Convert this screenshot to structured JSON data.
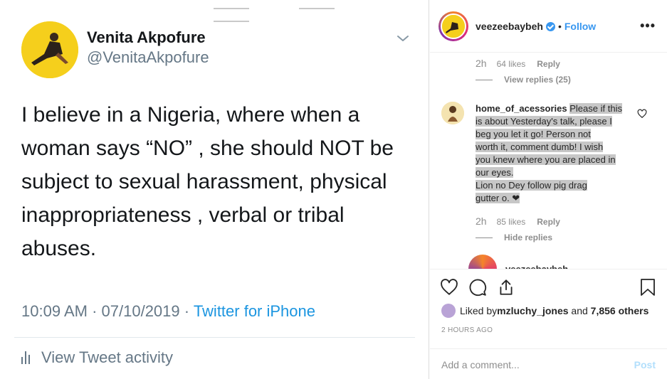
{
  "tweet": {
    "name": "Venita Akpofure",
    "handle": "@VenitaAkpofure",
    "text": "I believe in a Nigeria, where when a woman says “NO” , she should NOT be subject to sexual harassment, physical inappropriateness , verbal or tribal abuses.",
    "time": "10:09 AM",
    "date": "07/10/2019",
    "source": "Twitter for iPhone",
    "activity_label": "View Tweet activity",
    "accent": "#1b95e0",
    "avatar_color": "#f5cf1c"
  },
  "instagram": {
    "header": {
      "username": "veezeebaybeh",
      "follow_label": "Follow",
      "more_icon": "more-horizontal-icon"
    },
    "prev_comment": {
      "time": "2h",
      "likes": "64 likes",
      "reply_label": "Reply",
      "view_replies": "View replies (25)"
    },
    "comment": {
      "username": "home_of_acessories",
      "text_lines": [
        "Please if this",
        "is about Yesterday's talk, please I",
        "beg you let it go! Person not",
        "worth it, comment dumb! I wish",
        "you knew where you are placed in",
        "our eyes.",
        "Lion no Dey follow pig drag",
        "gutter o. ❤"
      ],
      "time": "2h",
      "likes": "85 likes",
      "reply_label": "Reply",
      "hide_replies": "Hide replies"
    },
    "reply_peek": {
      "username": "veezeebaybeh"
    },
    "actions": {
      "liked_prefix": "Liked by ",
      "liked_user": "mzluchy_jones",
      "liked_middle": " and ",
      "liked_count": "7,856 others",
      "post_time": "2 HOURS AGO"
    },
    "add_comment": {
      "placeholder": "Add a comment...",
      "post_label": "Post"
    },
    "accent": "#3897f0"
  }
}
